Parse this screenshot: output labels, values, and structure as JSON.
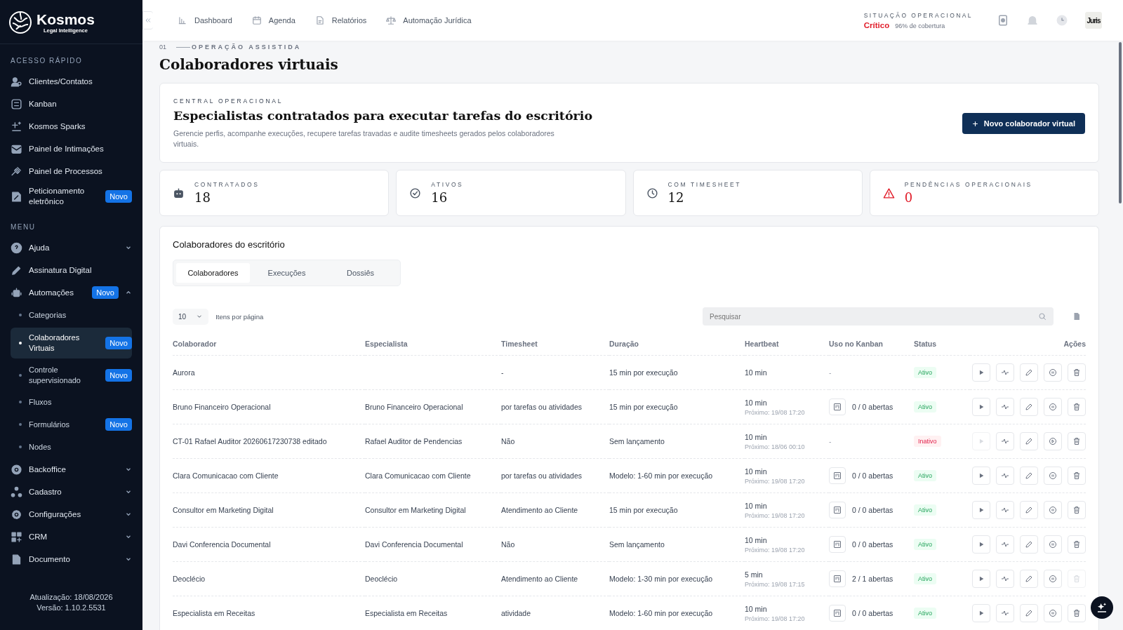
{
  "sidebar": {
    "logo": {
      "name": "Kosmos",
      "tagline": "Legal Intelligence"
    },
    "sections": [
      {
        "title": "ACESSO RÁPIDO",
        "items": [
          {
            "label": "Clientes/Contatos",
            "selected": false
          },
          {
            "label": "Kanban",
            "selected": false
          },
          {
            "label": "Kosmos Sparks",
            "selected": false
          },
          {
            "label": "Painel de Intimações",
            "selected": false
          },
          {
            "label": "Painel de Processos",
            "selected": false
          },
          {
            "label": "Peticionamento eletrônico",
            "badge": "Novo",
            "selected": false
          }
        ]
      },
      {
        "title": "MENU",
        "items": [
          {
            "label": "Ajuda",
            "expanded": false,
            "selected": false
          },
          {
            "label": "Assinatura Digital",
            "selected": false
          },
          {
            "label": "Automações",
            "badge": "Novo",
            "expanded": true,
            "selected": false,
            "children": [
              {
                "label": "Categorias",
                "selected": false
              },
              {
                "label": "Colaboradores Virtuais",
                "badge": "Novo",
                "selected": true
              },
              {
                "label": "Controle supervisionado",
                "badge": "Novo",
                "selected": false
              },
              {
                "label": "Fluxos",
                "selected": false
              },
              {
                "label": "Formulários",
                "badge": "Novo",
                "selected": false
              },
              {
                "label": "Nodes",
                "selected": false
              }
            ]
          },
          {
            "label": "Backoffice",
            "expanded": false,
            "selected": false
          },
          {
            "label": "Cadastro",
            "expanded": false,
            "selected": false
          },
          {
            "label": "Configurações",
            "expanded": false,
            "selected": false
          },
          {
            "label": "CRM",
            "expanded": false,
            "selected": false
          },
          {
            "label": "Documento",
            "expanded": false,
            "selected": false
          }
        ]
      }
    ],
    "footer": [
      "Atualização: 18/08/2026",
      "Versão: 1.10.2.5531"
    ]
  },
  "topbar": {
    "nav": [
      "Dashboard",
      "Agenda",
      "Relatórios",
      "Automação Jurídica"
    ],
    "status": {
      "label": "SITUAÇÃO OPERACIONAL",
      "level_text": "Crítico",
      "coverage": "96% de cobertura"
    },
    "avatar": "Juris"
  },
  "breadcrumb": {
    "index": "01",
    "label": "OPERAÇÃO ASSISTIDA"
  },
  "title": "Colaboradores virtuais",
  "hero": {
    "eyebrow": "CENTRAL OPERACIONAL",
    "heading": "Especialistas contratados para executar tarefas do escritório",
    "description": "Gerencie perfis, acompanhe execuções, recupere tarefas travadas e audite timesheets gerados pelos colaboradores virtuais.",
    "button": "Novo colaborador virtual"
  },
  "stats": [
    {
      "label": "CONTRATADOS",
      "value": "18",
      "alert": false
    },
    {
      "label": "ATIVOS",
      "value": "16",
      "alert": false
    },
    {
      "label": "COM TIMESHEET",
      "value": "12",
      "alert": false
    },
    {
      "label": "PENDÊNCIAS OPERACIONAIS",
      "value": "0",
      "alert": true
    }
  ],
  "table_card": {
    "title": "Colaboradores do escritório",
    "tabs": [
      {
        "label": "Colaboradores",
        "selected": true
      },
      {
        "label": "Execuções",
        "selected": false
      },
      {
        "label": "Dossiês",
        "selected": false
      }
    ],
    "page_size": "10",
    "page_size_label": "Itens por página",
    "search": {
      "placeholder": "Pesquisar"
    },
    "columns": [
      "Colaborador",
      "Especialista",
      "Timesheet",
      "Duração",
      "Heartbeat",
      "Uso no Kanban",
      "Status",
      "Ações"
    ],
    "rows": [
      {
        "name": "Aurora",
        "timesheet": "-",
        "duration": "15 min por execução",
        "heartbeat": "10 min",
        "kanban": "-",
        "kanban_linked": false,
        "status": "Ativo",
        "active": true,
        "run_disabled": false,
        "paused": false,
        "delete_disabled": false
      },
      {
        "name": "Bruno Financeiro Operacional",
        "specialist": "Bruno Financeiro Operacional",
        "timesheet": "por tarefas ou atividades",
        "duration": "15 min por execução",
        "heartbeat": "10 min",
        "next": "Próximo: 19/08 17:20",
        "kanban": "0 / 0 abertas",
        "kanban_linked": true,
        "status": "Ativo",
        "active": true,
        "run_disabled": false,
        "paused": false,
        "delete_disabled": false
      },
      {
        "name": "CT-01 Rafael Auditor 20260617230738 editado",
        "specialist": "Rafael Auditor de Pendencias",
        "timesheet": "Não",
        "duration": "Sem lançamento",
        "heartbeat": "10 min",
        "next": "Próximo: 18/06 00:10",
        "kanban": "-",
        "kanban_linked": false,
        "status": "Inativo",
        "active": false,
        "run_disabled": true,
        "paused": true,
        "delete_disabled": false
      },
      {
        "name": "Clara Comunicacao com Cliente",
        "specialist": "Clara Comunicacao com Cliente",
        "timesheet": "por tarefas ou atividades",
        "duration": "Modelo: 1-60 min por execução",
        "heartbeat": "10 min",
        "next": "Próximo: 19/08 17:20",
        "kanban": "0 / 0 abertas",
        "kanban_linked": true,
        "status": "Ativo",
        "active": true,
        "run_disabled": false,
        "paused": false,
        "delete_disabled": false
      },
      {
        "name": "Consultor em Marketing Digital",
        "specialist": "Consultor em Marketing Digital",
        "timesheet": "Atendimento ao Cliente",
        "duration": "15 min por execução",
        "heartbeat": "10 min",
        "next": "Próximo: 19/08 17:20",
        "kanban": "0 / 0 abertas",
        "kanban_linked": true,
        "status": "Ativo",
        "active": true,
        "run_disabled": false,
        "paused": false,
        "delete_disabled": false
      },
      {
        "name": "Davi Conferencia Documental",
        "specialist": "Davi Conferencia Documental",
        "timesheet": "Não",
        "duration": "Sem lançamento",
        "heartbeat": "10 min",
        "next": "Próximo: 19/08 17:20",
        "kanban": "0 / 0 abertas",
        "kanban_linked": true,
        "status": "Ativo",
        "active": true,
        "run_disabled": false,
        "paused": false,
        "delete_disabled": false
      },
      {
        "name": "Deoclécio",
        "specialist": "Deoclécio",
        "timesheet": "Atendimento ao Cliente",
        "duration": "Modelo: 1-30 min por execução",
        "heartbeat": "5 min",
        "next": "Próximo: 19/08 17:15",
        "kanban": "2 / 1 abertas",
        "kanban_linked": true,
        "status": "Ativo",
        "active": true,
        "run_disabled": false,
        "paused": false,
        "delete_disabled": true
      },
      {
        "name": "Especialista em Receitas",
        "specialist": "Especialista em Receitas",
        "timesheet": "atividade",
        "duration": "Modelo: 1-60 min por execução",
        "heartbeat": "10 min",
        "next": "Próximo: 19/08 17:20",
        "kanban": "0 / 0 abertas",
        "kanban_linked": true,
        "status": "Ativo",
        "active": true,
        "run_disabled": false,
        "paused": false,
        "delete_disabled": false
      }
    ]
  }
}
